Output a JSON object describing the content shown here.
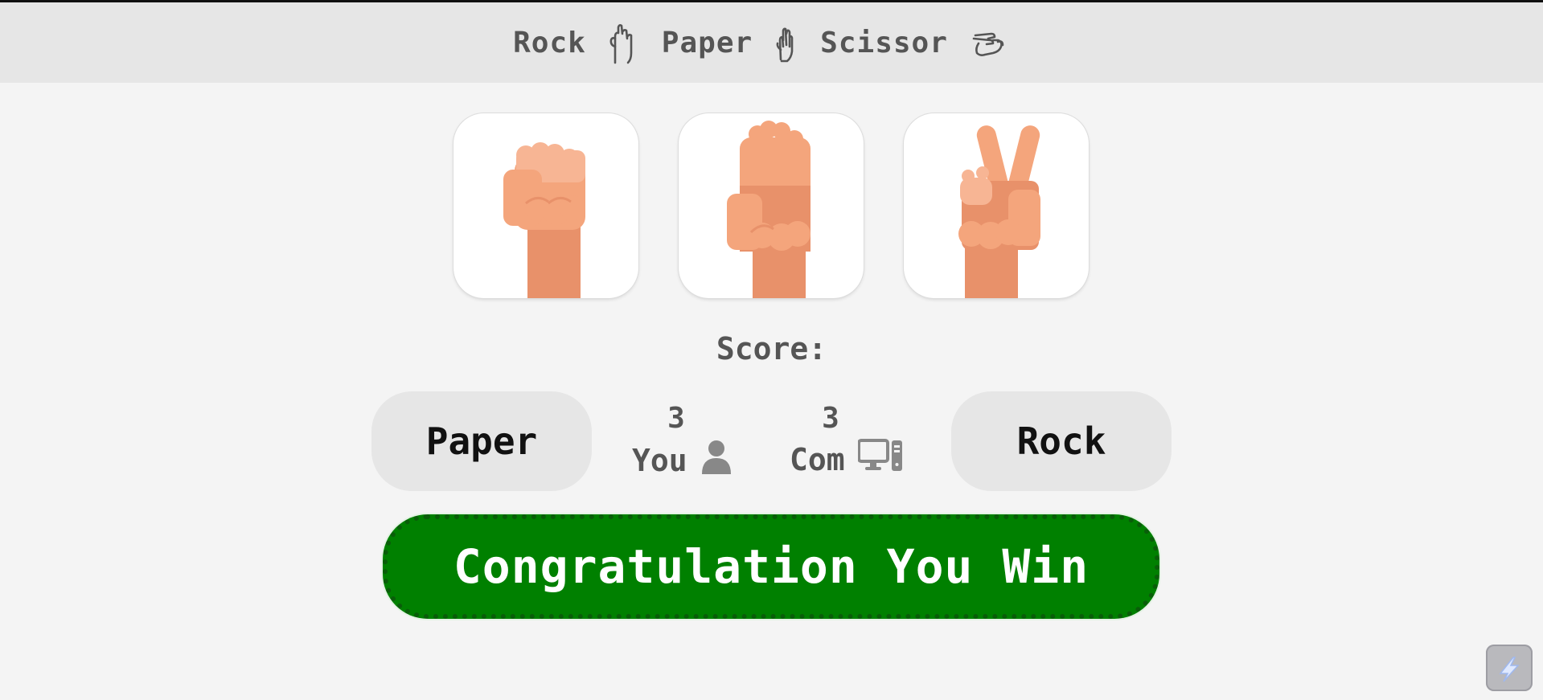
{
  "header": {
    "words": [
      "Rock",
      "Paper",
      "Scissor"
    ],
    "icons": [
      "rock-hand-icon",
      "paper-hand-icon",
      "scissor-hand-icon"
    ]
  },
  "choices": [
    {
      "name": "rock",
      "icon": "fist-icon"
    },
    {
      "name": "paper",
      "icon": "open-hand-icon"
    },
    {
      "name": "scissor",
      "icon": "victory-hand-icon"
    }
  ],
  "score": {
    "label": "Score:",
    "user_pick": "Paper",
    "computer_pick": "Rock",
    "you_label": "You",
    "you_score": "3",
    "com_label": "Com",
    "com_score": "3"
  },
  "result": {
    "message": "Congratulation You Win",
    "color": "#008000"
  },
  "colors": {
    "skin_dark": "#e8916a",
    "skin_light": "#f4a57c",
    "skin_highlight": "#f7b594",
    "header_bg": "#e6e6e6",
    "page_bg": "#f4f4f4"
  }
}
